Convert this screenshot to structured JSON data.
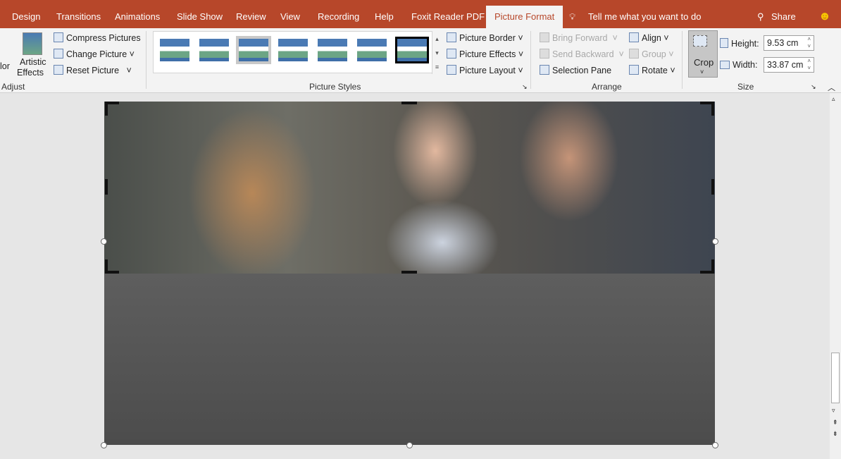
{
  "tabs": [
    "Design",
    "Transitions",
    "Animations",
    "Slide Show",
    "Review",
    "View",
    "Recording",
    "Help",
    "Foxit Reader PDF",
    "Picture Format"
  ],
  "active_tab": "Picture Format",
  "tell_me": "Tell me what you want to do",
  "share": "Share",
  "adjust": {
    "color_partial": "lor",
    "artistic_effects_1": "Artistic",
    "artistic_effects_2": "Effects",
    "compress": "Compress Pictures",
    "change": "Change Picture",
    "reset": "Reset Picture",
    "group": "Adjust"
  },
  "styles": {
    "group": "Picture Styles",
    "border": "Picture Border",
    "effects": "Picture Effects",
    "layout": "Picture Layout"
  },
  "arrange": {
    "bring_forward": "Bring Forward",
    "send_backward": "Send Backward",
    "selection_pane": "Selection Pane",
    "align": "Align",
    "group_btn": "Group",
    "rotate": "Rotate",
    "group": "Arrange"
  },
  "size": {
    "crop": "Crop",
    "height_label": "Height:",
    "height": "9.53 cm",
    "width_label": "Width:",
    "width": "33.87 cm",
    "group": "Size"
  },
  "colors": {
    "accent": "#b7472a"
  }
}
